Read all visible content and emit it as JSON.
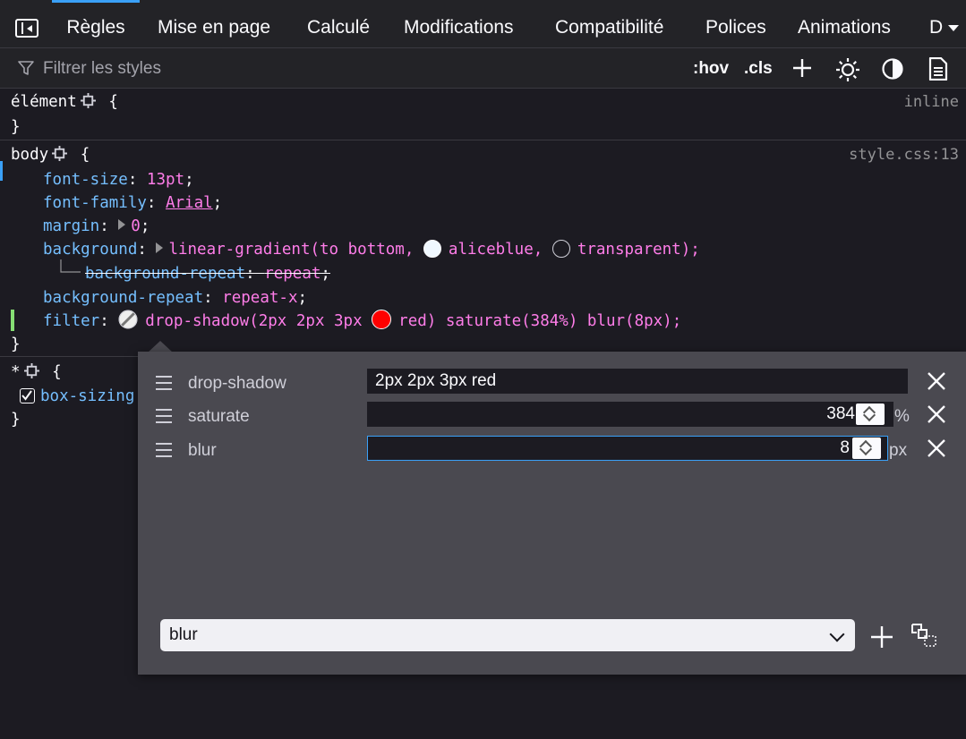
{
  "tabs": [
    {
      "label": "Règles",
      "active": true
    },
    {
      "label": "Mise en page"
    },
    {
      "label": "Calculé"
    },
    {
      "label": "Modifications"
    },
    {
      "label": "Compatibilité"
    },
    {
      "label": "Polices"
    },
    {
      "label": "Animations"
    },
    {
      "label": "D"
    }
  ],
  "toolbar": {
    "filter_placeholder": "Filtrer les styles",
    "hov_label": ":hov",
    "cls_label": ".cls"
  },
  "rules": {
    "element": {
      "selector": "élément",
      "open": "{",
      "close": "}",
      "source": "inline"
    },
    "body": {
      "selector": "body",
      "open": "{",
      "close": "}",
      "source": "style.css:13",
      "decls": {
        "font_size": {
          "name": "font-size",
          "value": "13pt"
        },
        "font_family": {
          "name": "font-family",
          "value": "Arial"
        },
        "margin": {
          "name": "margin",
          "value": "0"
        },
        "background": {
          "name": "background",
          "value_start": "linear-gradient(to bottom,",
          "color1": "aliceblue,",
          "color2": "transparent",
          "value_end": ");"
        },
        "background_repeat_sub": {
          "name": "background-repeat",
          "value": "repeat"
        },
        "background_repeat": {
          "name": "background-repeat",
          "value": "repeat-x"
        },
        "filter": {
          "name": "filter",
          "part1": "drop-shadow(2px 2px 3px",
          "part2": "red) saturate(384%) blur(8px);"
        }
      }
    },
    "universal": {
      "selector": "*",
      "open": "{",
      "close": "}",
      "decl_name": "box-sizing"
    }
  },
  "filter_editor": {
    "filters": [
      {
        "name": "drop-shadow",
        "value": "2px 2px 3px red",
        "unit": ""
      },
      {
        "name": "saturate",
        "value": "384",
        "unit": "%"
      },
      {
        "name": "blur",
        "value": "8",
        "unit": "px"
      }
    ],
    "preset_selected": "blur"
  },
  "colors": {
    "accent": "#3aa0f7",
    "property": "#75bfff",
    "value": "#ff7de9",
    "swatch_red": "#ff0000",
    "swatch_aliceblue": "#f0f8ff"
  }
}
